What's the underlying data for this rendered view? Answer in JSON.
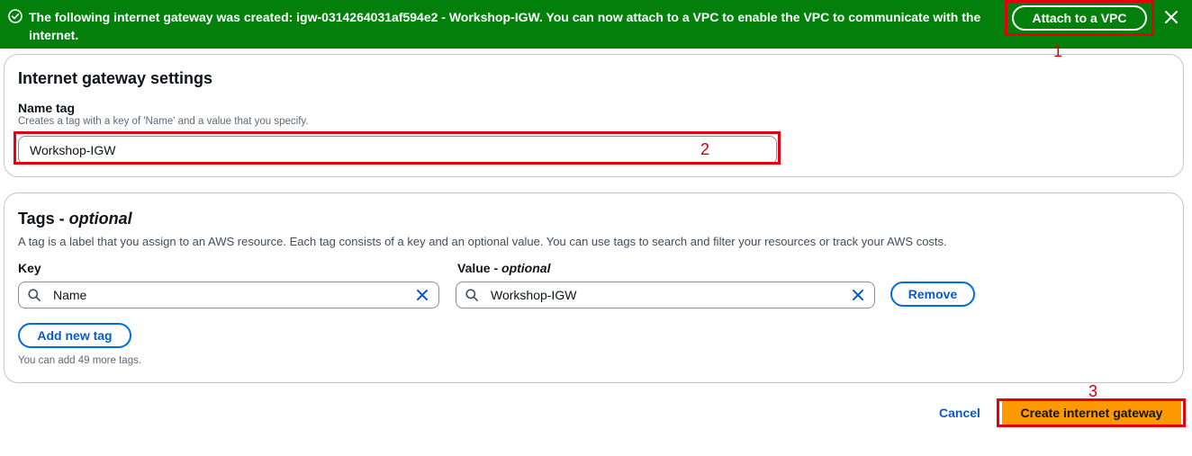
{
  "flash": {
    "message": "The following internet gateway was created: igw-0314264031af594e2 - Workshop-IGW. You can now attach to a VPC to enable the VPC to communicate with the internet.",
    "attach_label": "Attach to a VPC",
    "icon": "check-circle-icon",
    "background": "#037f0c"
  },
  "settings": {
    "title": "Internet gateway settings",
    "name_tag_label": "Name tag",
    "name_tag_description": "Creates a tag with a key of 'Name' and a value that you specify.",
    "name_tag_value": "Workshop-IGW"
  },
  "tags": {
    "title": "Tags - ",
    "title_optional": "optional",
    "description": "A tag is a label that you assign to an AWS resource. Each tag consists of a key and an optional value. You can use tags to search and filter your resources or track your AWS costs.",
    "key_label": "Key",
    "value_label": "Value - ",
    "value_label_optional": "optional",
    "rows": [
      {
        "key": "Name",
        "value": "Workshop-IGW",
        "remove_label": "Remove"
      }
    ],
    "add_label": "Add new tag",
    "remaining_note": "You can add 49 more tags."
  },
  "footer": {
    "cancel_label": "Cancel",
    "create_label": "Create internet gateway",
    "create_color": "#ff9900"
  },
  "annotations": {
    "one": "1",
    "two": "2",
    "three": "3",
    "color": "#e3000f"
  }
}
